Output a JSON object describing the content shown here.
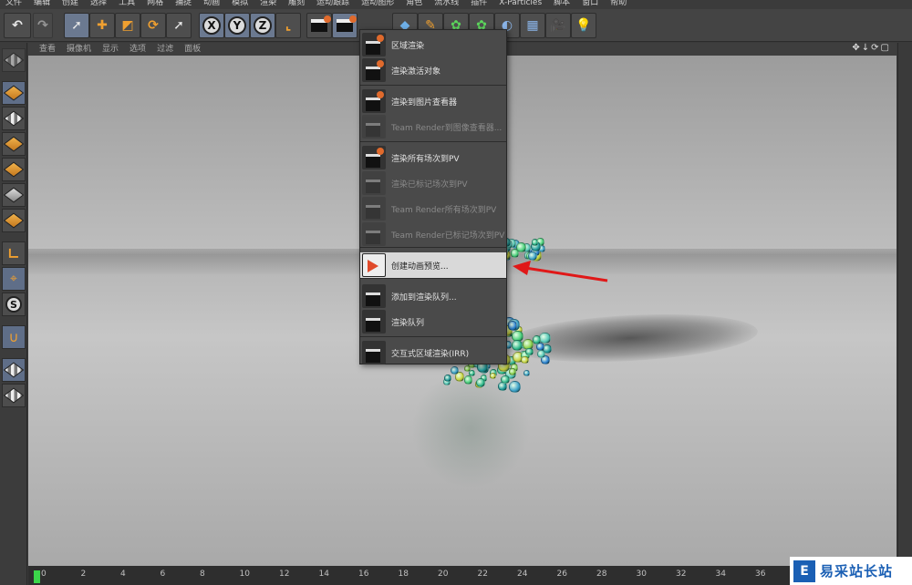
{
  "menubar": [
    "文件",
    "编辑",
    "创建",
    "选择",
    "工具",
    "网格",
    "捕捉",
    "动画",
    "模拟",
    "渲染",
    "雕刻",
    "运动跟踪",
    "运动图形",
    "角色",
    "流水线",
    "插件",
    "X-Particles",
    "脚本",
    "窗口",
    "帮助"
  ],
  "toolbar": {
    "axis_x": "X",
    "axis_y": "Y",
    "axis_z": "Z"
  },
  "viewport_menu": [
    "查看",
    "摄像机",
    "显示",
    "选项",
    "过滤",
    "面板"
  ],
  "render_menu": {
    "items": [
      {
        "label": "区域渲染",
        "enabled": true
      },
      {
        "label": "渲染激活对象",
        "enabled": true
      },
      {
        "label": "渲染到图片查看器",
        "enabled": true
      },
      {
        "label": "Team Render到图像查看器...",
        "enabled": false
      },
      {
        "label": "渲染所有场次到PV",
        "enabled": true
      },
      {
        "label": "渲染已标记场次到PV",
        "enabled": false
      },
      {
        "label": "Team Render所有场次到PV",
        "enabled": false
      },
      {
        "label": "Team Render已标记场次到PV",
        "enabled": false
      },
      {
        "label": "创建动画预览...",
        "enabled": true,
        "highlighted": true
      },
      {
        "label": "添加到渲染队列...",
        "enabled": true
      },
      {
        "label": "渲染队列",
        "enabled": true
      },
      {
        "label": "交互式区域渲染(IRR)",
        "enabled": true
      }
    ]
  },
  "timeline": {
    "ticks": [
      "0",
      "2",
      "4",
      "6",
      "8",
      "10",
      "12",
      "14",
      "16",
      "18",
      "20",
      "22",
      "24",
      "26",
      "28",
      "30",
      "32",
      "34",
      "36"
    ]
  },
  "watermark": {
    "text": "易采站长站"
  }
}
